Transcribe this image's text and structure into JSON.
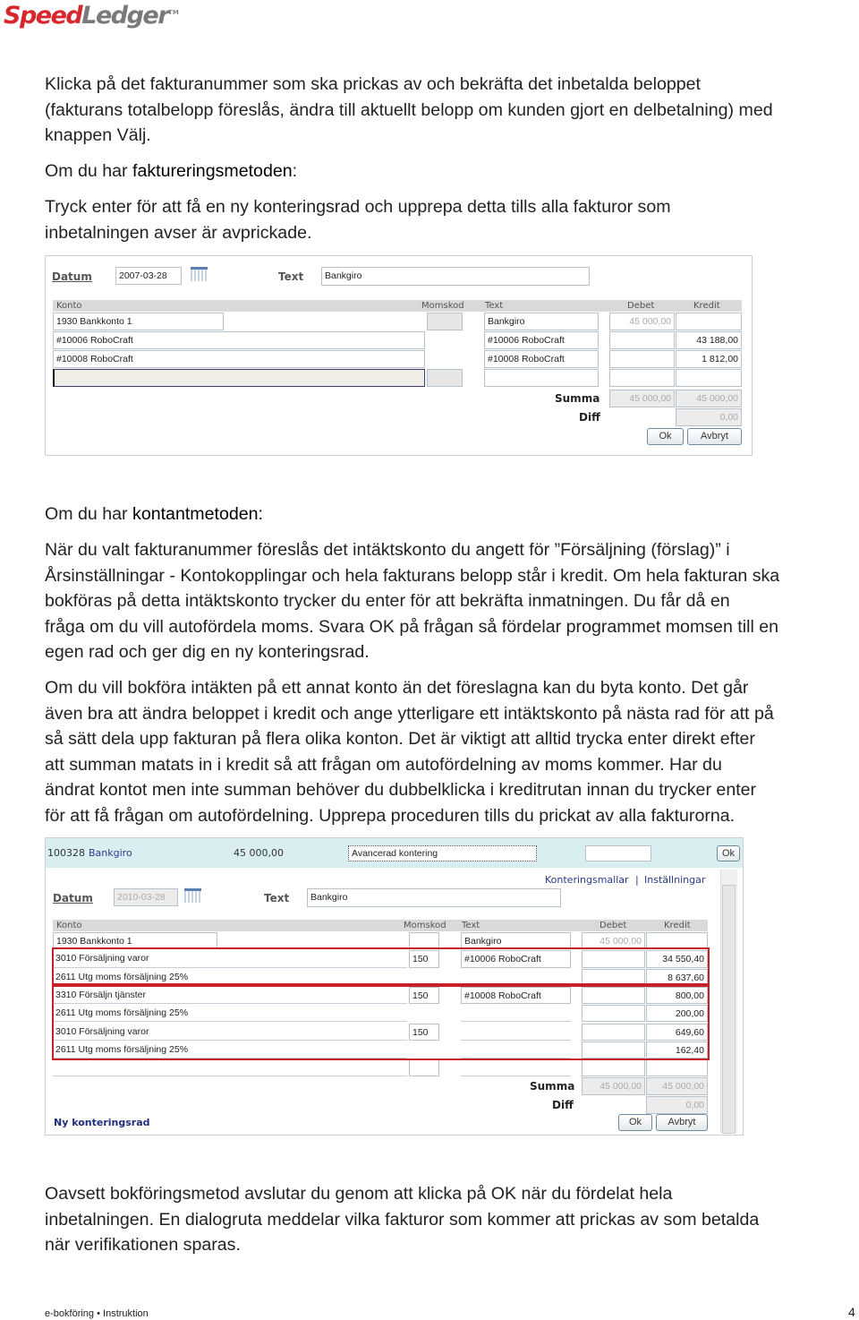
{
  "logo": {
    "part1": "Speed",
    "part2": "Ledger",
    "tm": "TM"
  },
  "paragraphs": {
    "p1": [
      "Klicka på det fakturanummer som ska prickas av och bekräfta det inbetalda beloppet",
      "(fakturans totalbelopp föreslås, ändra till aktuellt belopp om kunden gjort en delbetalning) med",
      "knappen Välj."
    ],
    "p2_prefix": "Om du har ",
    "p2_term": "faktureringsmetoden",
    ":": ":",
    "p3": [
      "Tryck enter för att få en ny konteringsrad och upprepa detta tills alla fakturor som",
      "inbetalningen avser är avprickade."
    ],
    "p4_prefix": "Om du har ",
    "p4_term": "kontantmetoden:",
    "p5": [
      "När du valt fakturanummer föreslås det intäktskonto du angett för ”Försäljning (förslag)” i",
      "Årsinställningar - Kontokopplingar och hela fakturans belopp står i kredit. Om hela fakturan ska",
      "bokföras på detta intäktskonto trycker du enter för att bekräfta inmatningen. Du får då en",
      "fråga om du vill autofördela moms. Svara OK på frågan så fördelar programmet momsen till en",
      "egen rad och ger dig en ny konteringsrad."
    ],
    "p6": [
      "Om du vill bokföra intäkten på ett annat konto än det föreslagna kan du byta konto. Det går",
      "även bra att ändra beloppet i kredit och ange ytterligare ett intäktskonto på nästa rad för att på",
      "så sätt dela upp fakturan på flera olika konton. Det är viktigt att alltid trycka enter direkt efter",
      "att summan matats in i kredit så att frågan om autofördelning av moms kommer. Har du",
      "ändrat kontot men inte summan behöver du dubbelklicka i kreditrutan innan du trycker enter",
      "för att få frågan om autofördelning. Upprepa proceduren tills du prickat av alla fakturorna."
    ],
    "p7": [
      "Oavsett bokföringsmetod avslutar du genom att klicka på OK när du fördelat hela",
      "inbetalningen. En dialogruta meddelar vilka fakturor som kommer att prickas av som betalda",
      "när verifikationen sparas."
    ]
  },
  "shot1": {
    "datum_label": "Datum",
    "datum_value": "2007-03-28",
    "text_label": "Text",
    "text_value": "Bankgiro",
    "headers": {
      "konto": "Konto",
      "momskod": "Momskod",
      "text": "Text",
      "debet": "Debet",
      "kredit": "Kredit"
    },
    "rows": [
      {
        "konto": "1930 Bankkonto 1",
        "momskod": "",
        "text": "Bankgiro",
        "debet": "45 000,00",
        "kredit": ""
      },
      {
        "konto": "#10006 RoboCraft",
        "momskod": "",
        "text": "#10006 RoboCraft",
        "debet": "",
        "kredit": "43 188,00"
      },
      {
        "konto": "#10008 RoboCraft",
        "momskod": "",
        "text": "#10008 RoboCraft",
        "debet": "",
        "kredit": "1 812,00"
      },
      {
        "konto": "",
        "momskod": "",
        "text": "",
        "debet": "",
        "kredit": ""
      }
    ],
    "summa_label": "Summa",
    "summa_debet": "45 000,00",
    "summa_kredit": "45 000,00",
    "diff_label": "Diff",
    "diff_value": "0,00",
    "ok": "Ok",
    "cancel": "Avbryt"
  },
  "shot2": {
    "top_id": "100328",
    "top_name": "Bankgiro",
    "top_amount": "45 000,00",
    "mode_select": "Avancerad kontering",
    "top_ok": "Ok",
    "link1": "Konteringsmallar",
    "link_sep": "|",
    "link2": "Inställningar",
    "datum_label": "Datum",
    "datum_value": "2010-03-28",
    "text_label": "Text",
    "text_value": "Bankgiro",
    "headers": {
      "konto": "Konto",
      "momskod": "Momskod",
      "text": "Text",
      "debet": "Debet",
      "kredit": "Kredit"
    },
    "rows": [
      {
        "konto": "1930 Bankkonto 1",
        "momskod": "",
        "text": "Bankgiro",
        "debet": "45 000,00",
        "kredit": ""
      },
      {
        "konto": "3010 Försäljning varor",
        "momskod": "150",
        "text": "#10006 RoboCraft",
        "debet": "",
        "kredit": "34 550,40"
      },
      {
        "konto": "2611 Utg moms försäljning 25%",
        "momskod": "",
        "text": "",
        "debet": "",
        "kredit": "8 637,60"
      },
      {
        "konto": "3310 Försäljn tjänster",
        "momskod": "150",
        "text": "#10008 RoboCraft",
        "debet": "",
        "kredit": "800,00"
      },
      {
        "konto": "2611 Utg moms försäljning 25%",
        "momskod": "",
        "text": "",
        "debet": "",
        "kredit": "200,00"
      },
      {
        "konto": "3010 Försäljning varor",
        "momskod": "150",
        "text": "",
        "debet": "",
        "kredit": "649,60"
      },
      {
        "konto": "2611 Utg moms försäljning 25%",
        "momskod": "",
        "text": "",
        "debet": "",
        "kredit": "162,40"
      },
      {
        "konto": "",
        "momskod": "",
        "text": "",
        "debet": "",
        "kredit": ""
      }
    ],
    "summa_label": "Summa",
    "summa_debet": "45 000,00",
    "summa_kredit": "45 000,00",
    "diff_label": "Diff",
    "diff_value": "0,00",
    "new_row_link": "Ny konteringsrad",
    "ok": "Ok",
    "cancel": "Avbryt"
  },
  "footer": {
    "left1": "e-bokföring",
    "bullet": "•",
    "left2": "Instruktion",
    "page": "4"
  },
  "colors": {
    "logo_red": "#d8262d",
    "logo_gray": "#7a7a7a",
    "highlight_red": "#c8202a",
    "top_bar": "#d9eef0",
    "link": "#2a3a8a"
  }
}
